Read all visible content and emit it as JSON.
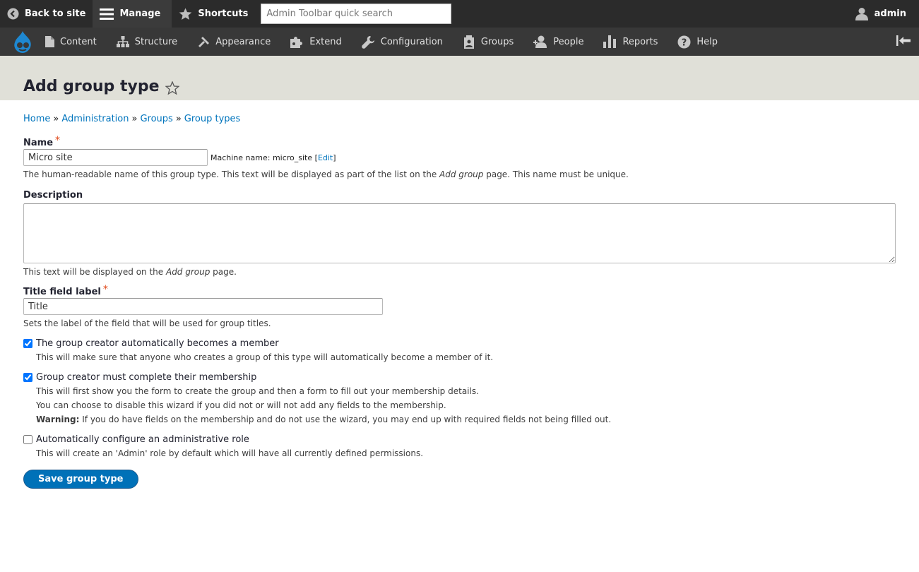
{
  "toolbar": {
    "back_to_site": "Back to site",
    "manage": "Manage",
    "shortcuts": "Shortcuts",
    "search_placeholder": "Admin Toolbar quick search",
    "user": "admin"
  },
  "menu": {
    "items": [
      {
        "label": "Content",
        "icon": "page-icon"
      },
      {
        "label": "Structure",
        "icon": "sitemap-icon"
      },
      {
        "label": "Appearance",
        "icon": "paintbrush-icon"
      },
      {
        "label": "Extend",
        "icon": "puzzle-icon"
      },
      {
        "label": "Configuration",
        "icon": "wrench-icon"
      },
      {
        "label": "Groups",
        "icon": "groups-icon"
      },
      {
        "label": "People",
        "icon": "people-icon"
      },
      {
        "label": "Reports",
        "icon": "bar-chart-icon"
      },
      {
        "label": "Help",
        "icon": "help-icon"
      }
    ]
  },
  "page": {
    "title": "Add group type"
  },
  "breadcrumb": [
    "Home",
    "Administration",
    "Groups",
    "Group types"
  ],
  "breadcrumb_sep": "»",
  "form": {
    "name": {
      "label": "Name",
      "required_mark": "*",
      "value": "Micro site",
      "machine_prefix": "Machine name: micro_site [",
      "machine_link": "Edit",
      "machine_suffix": "]",
      "desc_before": "The human-readable name of this group type. This text will be displayed as part of the list on the ",
      "desc_em": "Add group",
      "desc_after": " page. This name must be unique."
    },
    "description": {
      "label": "Description",
      "value": "",
      "desc_before": "This text will be displayed on the ",
      "desc_em": "Add group",
      "desc_after": " page."
    },
    "title_field": {
      "label": "Title field label",
      "required_mark": "*",
      "value": "Title",
      "desc": "Sets the label of the field that will be used for group titles."
    },
    "creator_member": {
      "label": "The group creator automatically becomes a member",
      "checked": true,
      "desc": "This will make sure that anyone who creates a group of this type will automatically become a member of it."
    },
    "creator_wizard": {
      "label": "Group creator must complete their membership",
      "checked": true,
      "desc1": "This will first show you the form to create the group and then a form to fill out your membership details.",
      "desc2": "You can choose to disable this wizard if you did not or will not add any fields to the membership.",
      "warning_label": "Warning:",
      "warning_text": " If you do have fields on the membership and do not use the wizard, you may end up with required fields not being filled out."
    },
    "admin_role": {
      "label": "Automatically configure an administrative role",
      "checked": false,
      "desc": "This will create an 'Admin' role by default which will have all currently defined permissions."
    },
    "submit": "Save group type"
  }
}
